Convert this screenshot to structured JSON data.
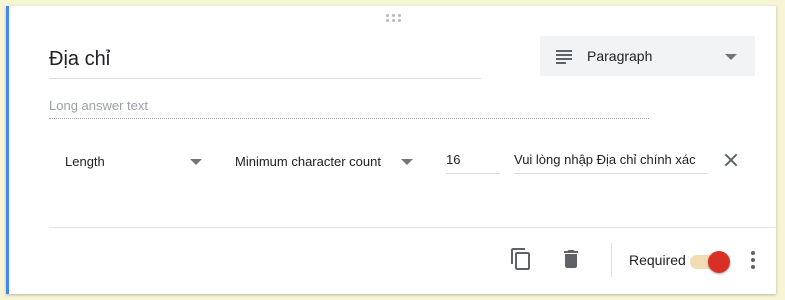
{
  "question": {
    "title": "Địa chỉ",
    "answer_placeholder": "Long answer text"
  },
  "type_selector": {
    "label": "Paragraph",
    "icon": "paragraph-lines-icon"
  },
  "validation": {
    "rule_type": "Length",
    "condition": "Minimum character count",
    "value": "16",
    "error_text": "Vui lòng nhập Địa chỉ chính xác"
  },
  "footer": {
    "required_label": "Required",
    "required_on": true
  },
  "colors": {
    "accent": "#4285f4",
    "toggle_knob": "#d93025",
    "toggle_track": "#f2dcb3"
  }
}
